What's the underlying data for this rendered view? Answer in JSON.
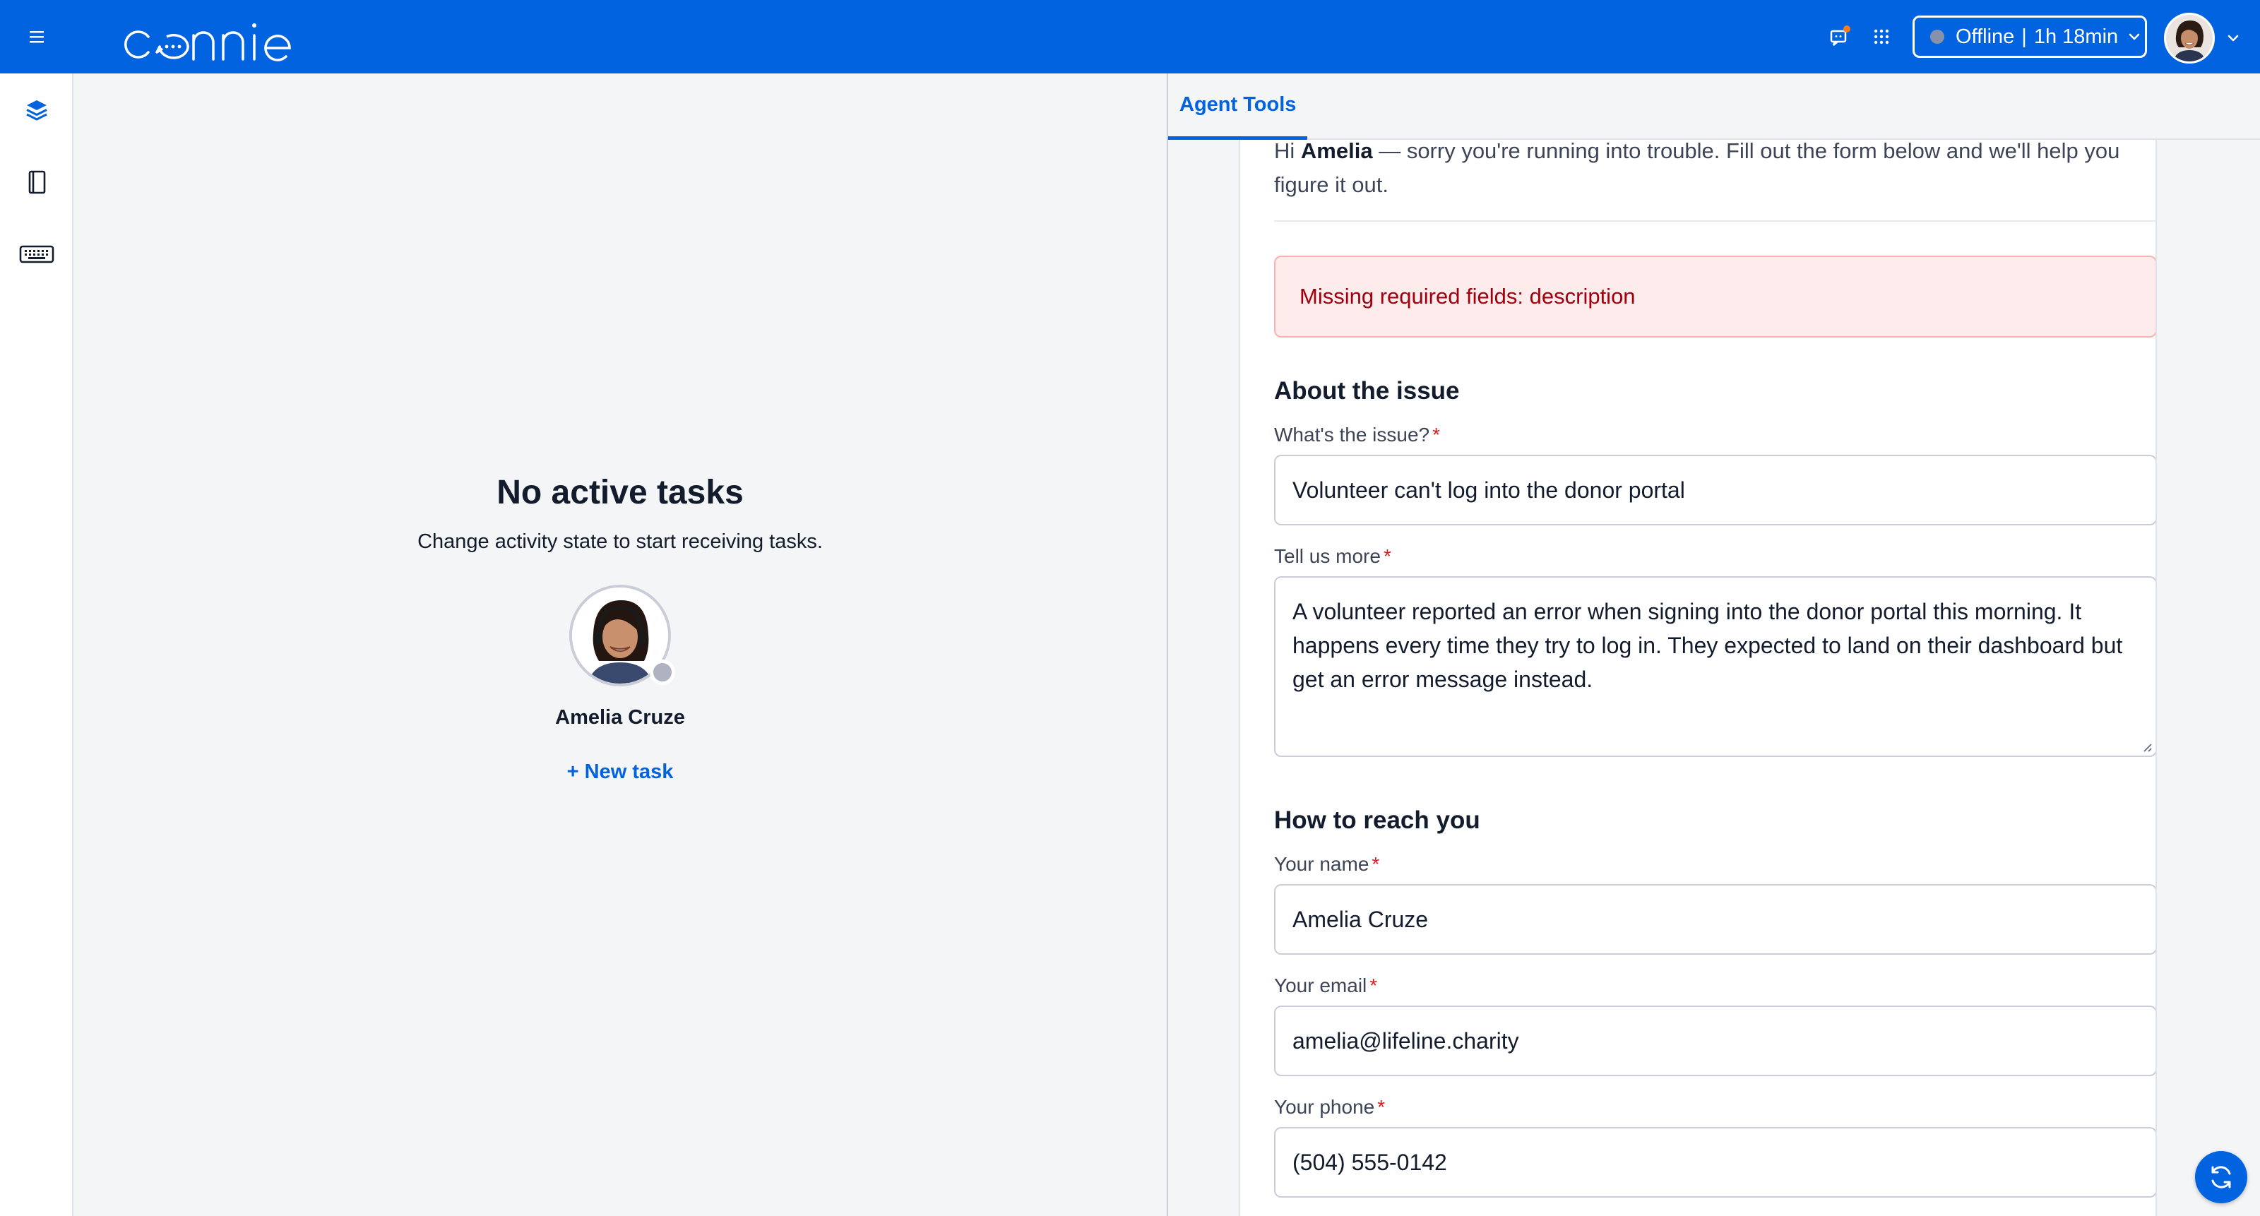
{
  "app": {
    "logo_text": "connie"
  },
  "header": {
    "status_label": "Offline",
    "status_time": "1h 18min"
  },
  "sidenav": {
    "items": [
      "layers-icon",
      "notebook-icon",
      "keyboard-icon"
    ]
  },
  "tasks": {
    "empty_title": "No active tasks",
    "empty_subtitle": "Change activity state to start receiving tasks.",
    "agent_name": "Amelia Cruze",
    "new_task_label": "+ New task"
  },
  "agent_tools": {
    "tab_label": "Agent Tools",
    "intro_prefix": "Hi",
    "intro_name": "Amelia",
    "intro_suffix": "— sorry you're running into trouble. Fill out the form below and we'll help you figure it out.",
    "alert": "Missing required fields: description",
    "section_issue": "About the issue",
    "issue_label": "What's the issue?",
    "issue_value": "Volunteer can't log into the donor portal",
    "more_label": "Tell us more",
    "more_value": "A volunteer reported an error when signing into the donor portal this morning. It happens every time they try to log in. They expected to land on their dashboard but get an error message instead.",
    "section_reach": "How to reach you",
    "name_label": "Your name",
    "name_value": "Amelia Cruze",
    "email_label": "Your email",
    "email_value": "amelia@lifeline.charity",
    "phone_label": "Your phone",
    "phone_value": "(504) 555-0142",
    "required_mark": "*"
  },
  "colors": {
    "brand": "#0263e0",
    "alert_bg": "#feecec",
    "alert_text": "#a0000e",
    "required": "#d61f1f"
  }
}
